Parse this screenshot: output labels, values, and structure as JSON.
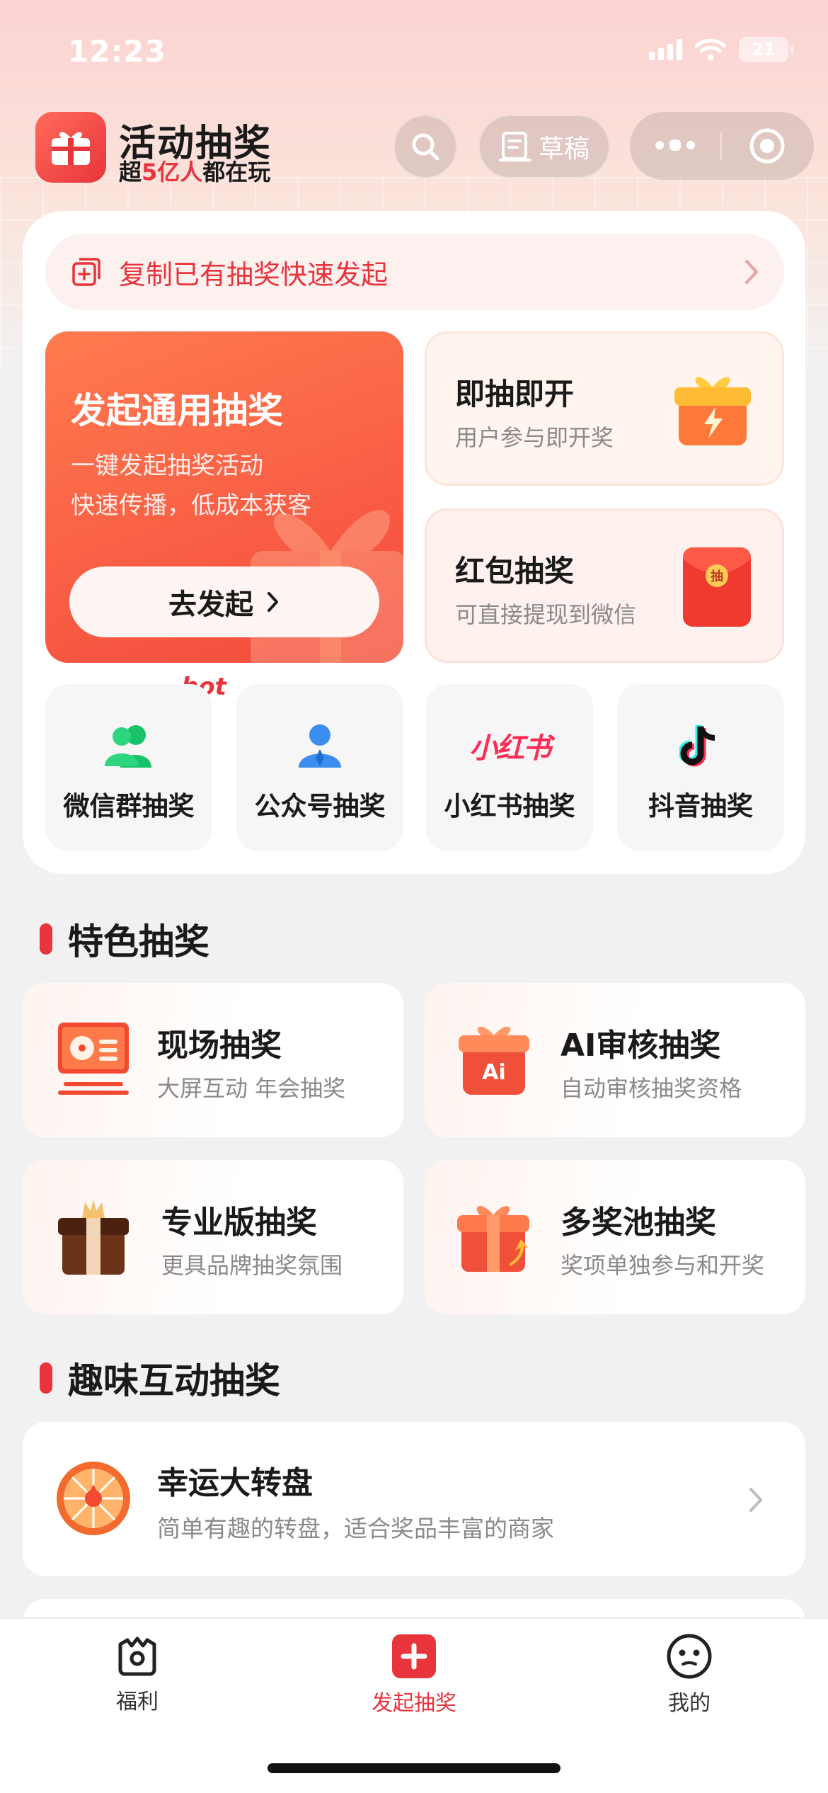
{
  "status_bar": {
    "time": "12:23",
    "battery": "21"
  },
  "header": {
    "brand_title": "活动抽奖",
    "brand_sub_prefix": "超",
    "brand_sub_highlight": "5亿人",
    "brand_sub_suffix": "都在玩",
    "draft_label": "草稿"
  },
  "copy_bar": {
    "text": "复制已有抽奖快速发起"
  },
  "general_card": {
    "title": "发起通用抽奖",
    "desc_line1": "一键发起抽奖活动",
    "desc_line2": "快速传播，低成本获客",
    "button_label": "去发起"
  },
  "side_cards": [
    {
      "title": "即抽即开",
      "subtitle": "用户参与即开奖"
    },
    {
      "title": "红包抽奖",
      "subtitle": "可直接提现到微信"
    }
  ],
  "platforms": {
    "hot_tag": "hot",
    "items": [
      {
        "label": "微信群抽奖"
      },
      {
        "label": "公众号抽奖"
      },
      {
        "label": "小红书抽奖",
        "logo_text": "小红书"
      },
      {
        "label": "抖音抽奖"
      }
    ]
  },
  "featured_section": {
    "title": "特色抽奖",
    "items": [
      {
        "title": "现场抽奖",
        "subtitle": "大屏互动 年会抽奖"
      },
      {
        "title": "AI审核抽奖",
        "subtitle": "自动审核抽奖资格",
        "icon_text": "Ai"
      },
      {
        "title": "专业版抽奖",
        "subtitle": "更具品牌抽奖氛围"
      },
      {
        "title": "多奖池抽奖",
        "subtitle": "奖项单独参与和开奖"
      }
    ]
  },
  "fun_section": {
    "title": "趣味互动抽奖",
    "items": [
      {
        "title": "幸运大转盘",
        "subtitle": "简单有趣的转盘，适合奖品丰富的商家"
      }
    ]
  },
  "tabbar": {
    "items": [
      {
        "label": "福利"
      },
      {
        "label": "发起抽奖"
      },
      {
        "label": "我的"
      }
    ]
  },
  "colors": {
    "accent": "#e8343b",
    "orange": "#ff7b4f"
  }
}
